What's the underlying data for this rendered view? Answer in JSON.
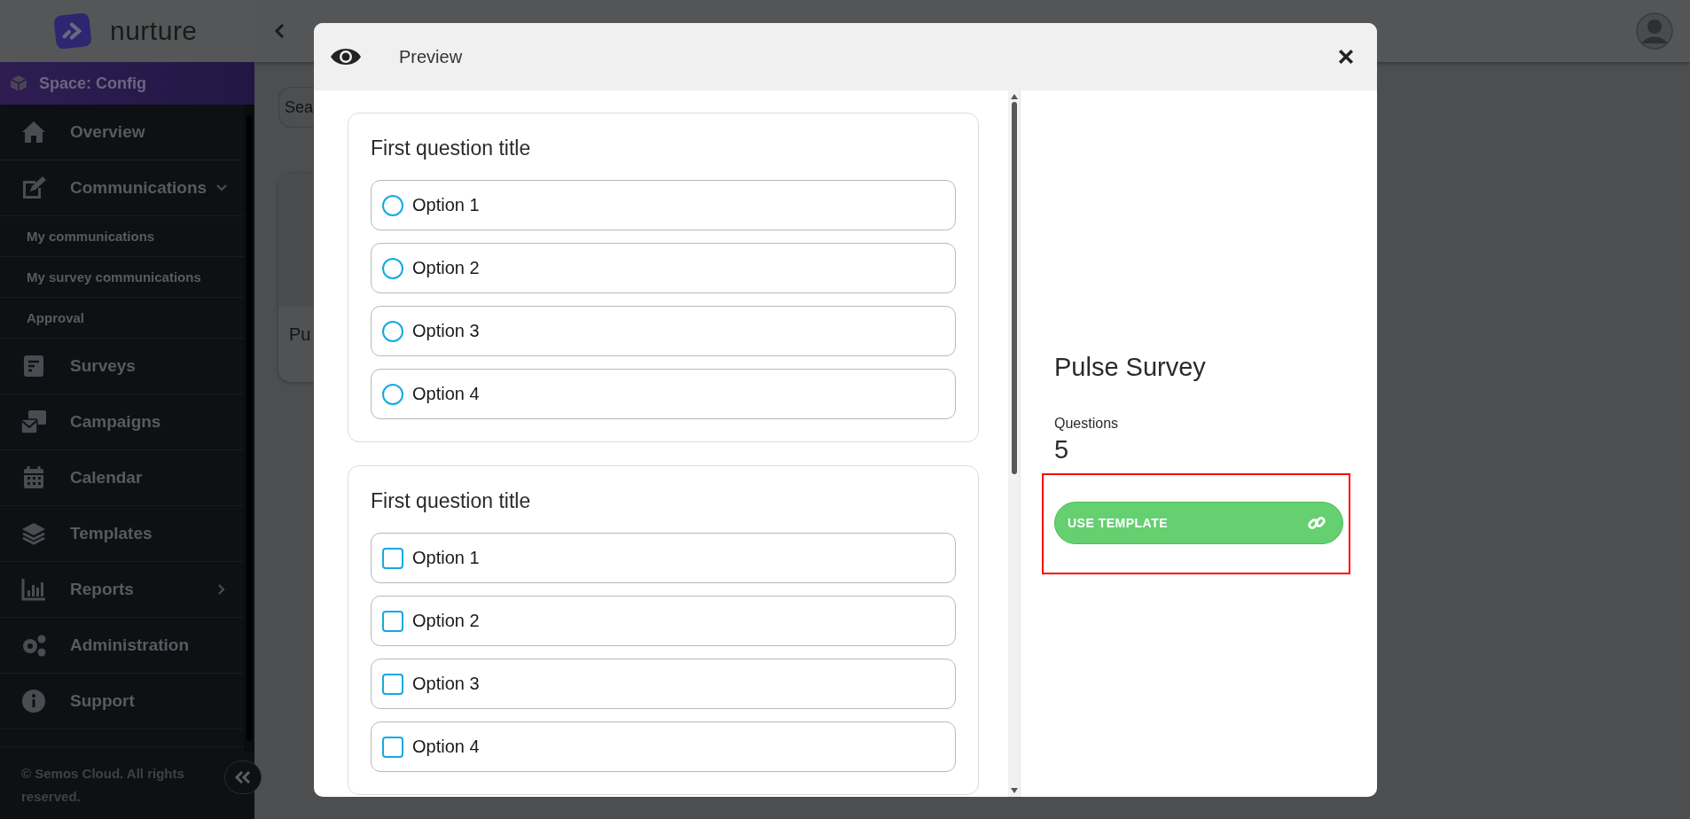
{
  "app": {
    "logo": "nurture",
    "space": "Space: Config",
    "nav": [
      {
        "label": "Overview"
      },
      {
        "label": "Communications",
        "expanded": true,
        "children": [
          {
            "label": "My communications"
          },
          {
            "label": "My survey communications"
          },
          {
            "label": "Approval"
          }
        ]
      },
      {
        "label": "Surveys"
      },
      {
        "label": "Campaigns"
      },
      {
        "label": "Calendar"
      },
      {
        "label": "Templates"
      },
      {
        "label": "Reports",
        "expanded": false
      },
      {
        "label": "Administration"
      },
      {
        "label": "Support"
      }
    ],
    "footer": "© Semos Cloud. All rights reserved.",
    "search": {
      "placeholder": "Sea"
    },
    "card": {
      "title": "Pu"
    }
  },
  "modal": {
    "title": "Preview",
    "questions": [
      {
        "title": "First question title",
        "kind": "radio",
        "options": [
          {
            "label": "Option 1",
            "checked": false
          },
          {
            "label": "Option 2",
            "checked": false
          },
          {
            "label": "Option 3",
            "checked": false
          },
          {
            "label": "Option 4",
            "checked": false
          }
        ]
      },
      {
        "title": "First question title",
        "kind": "checkbox",
        "options": [
          {
            "label": "Option 1",
            "checked": false
          },
          {
            "label": "Option 2",
            "checked": false
          },
          {
            "label": "Option 3",
            "checked": false
          },
          {
            "label": "Option 4",
            "checked": false
          }
        ]
      }
    ],
    "survey": {
      "name": "Pulse Survey",
      "stat_label": "Questions",
      "stat_value": "5",
      "button": "USE TEMPLATE"
    }
  }
}
